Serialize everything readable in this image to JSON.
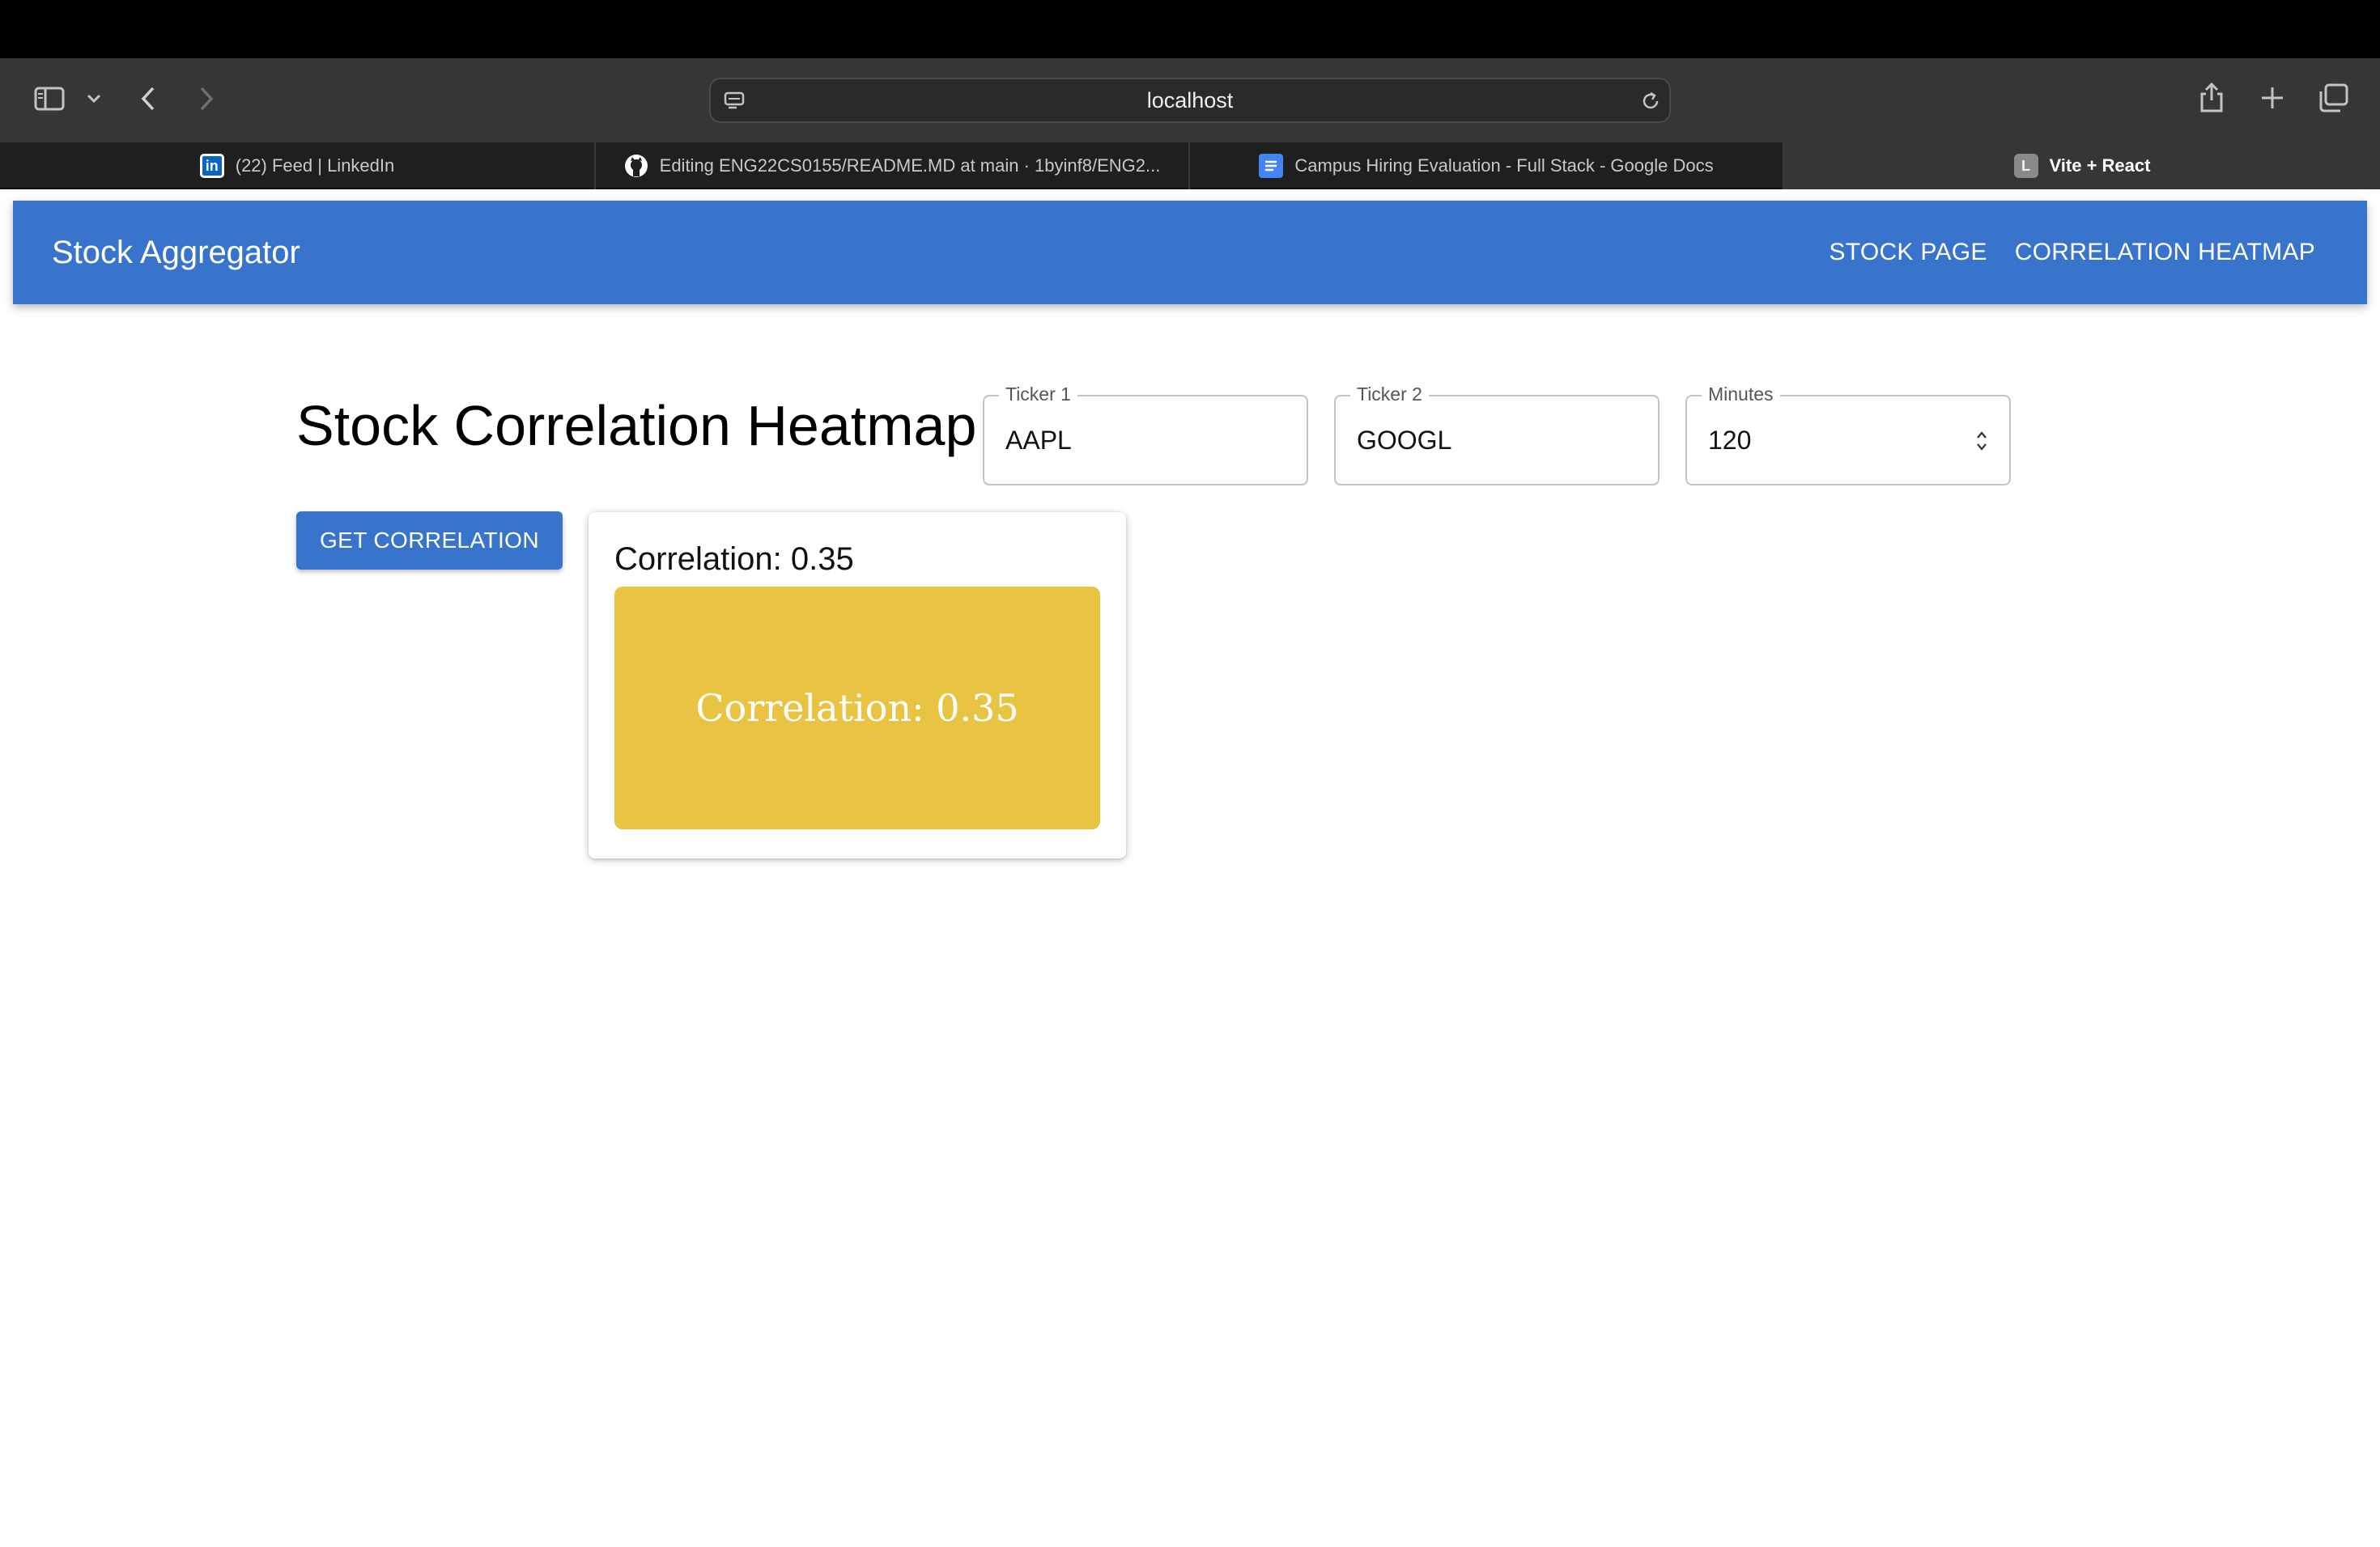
{
  "browser": {
    "url": "localhost",
    "tabs": [
      {
        "label": "(22) Feed | LinkedIn",
        "favicon": "linkedin-icon"
      },
      {
        "label": "Editing ENG22CS0155/README.MD at main · 1byinf8/ENG2...",
        "favicon": "github-icon"
      },
      {
        "label": "Campus Hiring Evaluation - Full Stack - Google Docs",
        "favicon": "google-docs-icon"
      },
      {
        "label": "Vite + React",
        "favicon": "vite-letter-icon",
        "favicon_letter": "L",
        "active": true
      }
    ]
  },
  "app": {
    "brand": "Stock Aggregator",
    "nav": {
      "stock_page": "STOCK PAGE",
      "correlation_heatmap": "CORRELATION HEATMAP"
    },
    "page_title": "Stock Correlation Heatmap",
    "fields": {
      "ticker1": {
        "label": "Ticker 1",
        "value": "AAPL"
      },
      "ticker2": {
        "label": "Ticker 2",
        "value": "GOOGL"
      },
      "minutes": {
        "label": "Minutes",
        "value": "120"
      }
    },
    "get_button": "GET CORRELATION",
    "result": {
      "title": "Correlation: 0.35",
      "cell_text": "Correlation: 0.35",
      "correlation": 0.35
    }
  },
  "colors": {
    "appbar": "#3874cb",
    "heat_cell": "#e9c442",
    "toolbar": "#363636",
    "tabbar": "#1f1f1f"
  }
}
